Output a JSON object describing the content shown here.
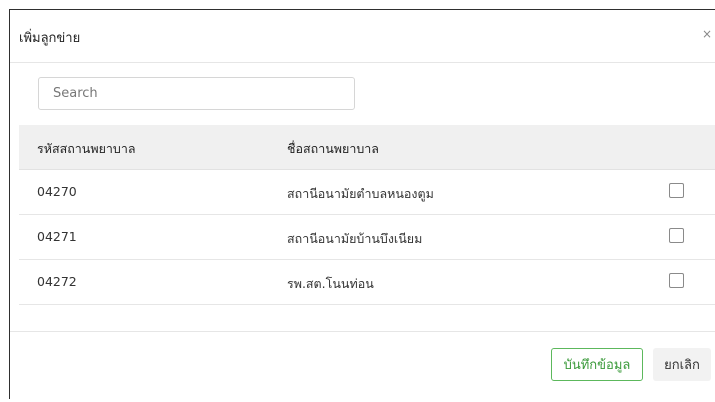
{
  "modal": {
    "title": "เพิ่มลูกข่าย",
    "close_label": "×"
  },
  "search": {
    "placeholder": "Search",
    "value": ""
  },
  "table": {
    "headers": [
      "รหัสสถานพยาบาล",
      "ชื่อสถานพยาบาล"
    ],
    "rows": [
      {
        "code": "04270",
        "name": "สถานีอนามัยตำบลหนองตูม",
        "checked": false
      },
      {
        "code": "04271",
        "name": "สถานีอนามัยบ้านบึงเนียม",
        "checked": false
      },
      {
        "code": "04272",
        "name": "รพ.สต.โนนท่อน",
        "checked": false
      }
    ]
  },
  "footer": {
    "save_label": "บันทึกข้อมูล",
    "cancel_label": "ยกเลิก"
  },
  "colors": {
    "save_border": "#5cb85c",
    "save_text": "#3a9a3a",
    "header_bg": "#f0f0f0",
    "cancel_bg": "#f2f2f2"
  }
}
